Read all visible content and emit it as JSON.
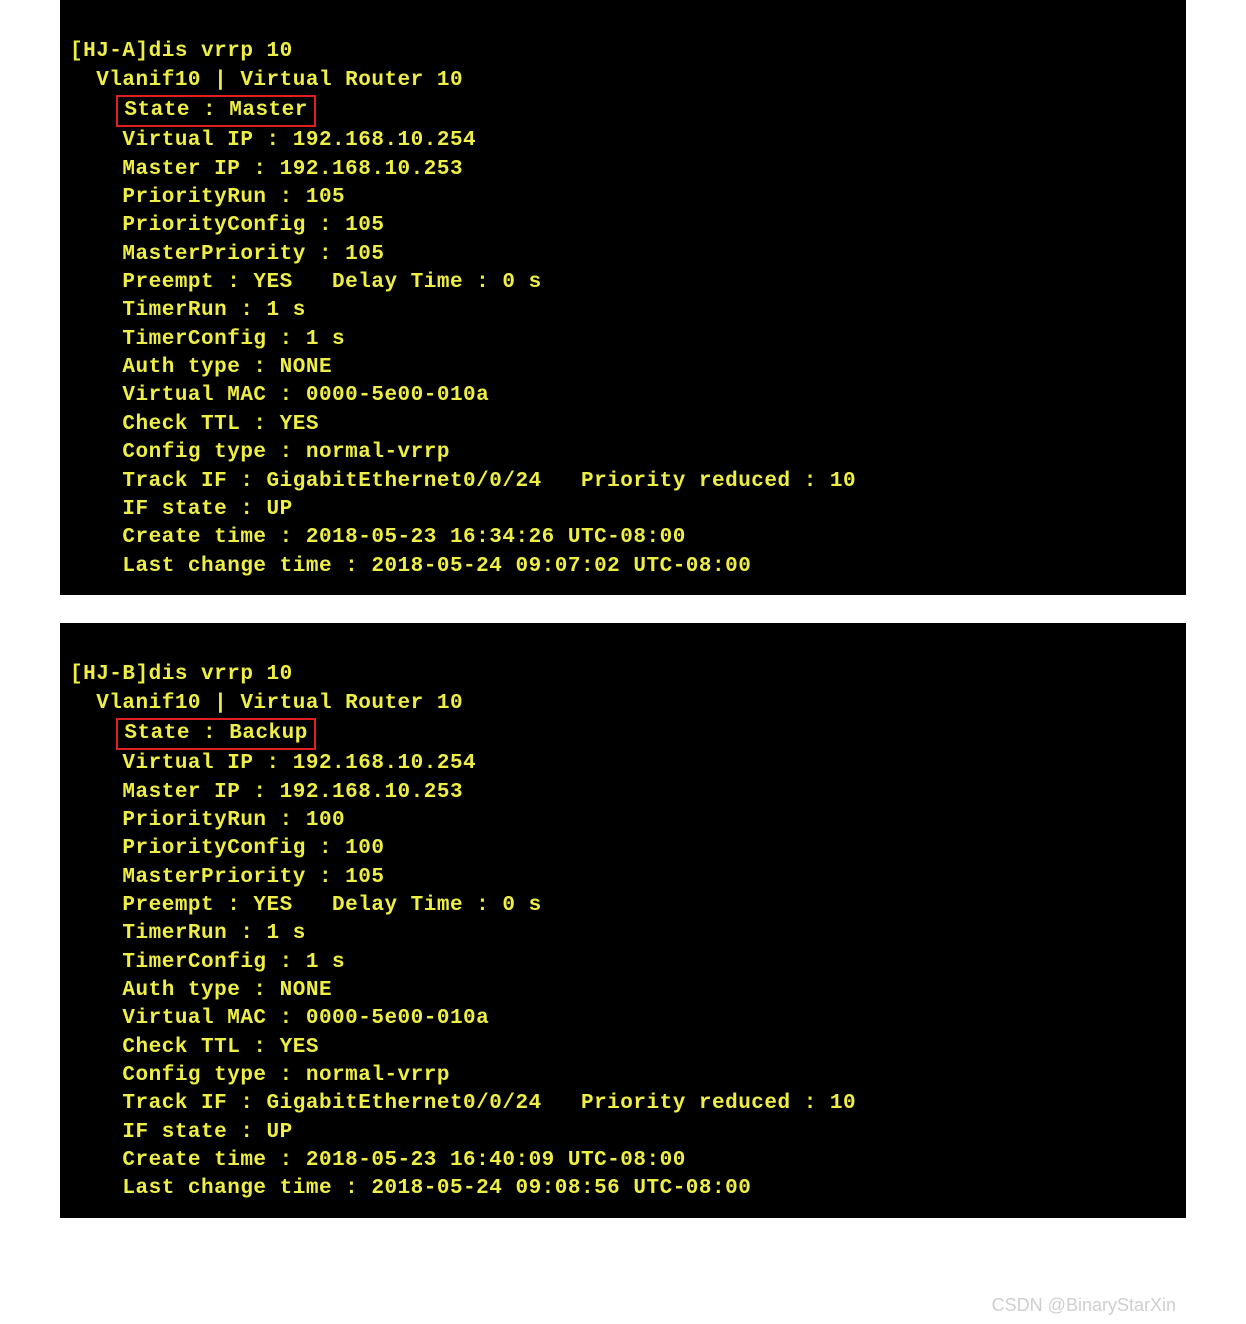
{
  "watermark": "CSDN @BinaryStarXin",
  "blocks": [
    {
      "id": "a",
      "prompt": "[HJ-A]dis vrrp 10",
      "header": "  Vlanif10 | Virtual Router 10",
      "state_line": "State : Master",
      "lines": [
        "    Virtual IP : 192.168.10.254",
        "    Master IP : 192.168.10.253",
        "    PriorityRun : 105",
        "    PriorityConfig : 105",
        "    MasterPriority : 105",
        "    Preempt : YES   Delay Time : 0 s",
        "    TimerRun : 1 s",
        "    TimerConfig : 1 s",
        "    Auth type : NONE",
        "    Virtual MAC : 0000-5e00-010a",
        "    Check TTL : YES",
        "    Config type : normal-vrrp",
        "    Track IF : GigabitEthernet0/0/24   Priority reduced : 10",
        "    IF state : UP",
        "    Create time : 2018-05-23 16:34:26 UTC-08:00",
        "    Last change time : 2018-05-24 09:07:02 UTC-08:00"
      ]
    },
    {
      "id": "b",
      "prompt": "[HJ-B]dis vrrp 10",
      "header": "  Vlanif10 | Virtual Router 10",
      "state_line": "State : Backup",
      "lines": [
        "    Virtual IP : 192.168.10.254",
        "    Master IP : 192.168.10.253",
        "    PriorityRun : 100",
        "    PriorityConfig : 100",
        "    MasterPriority : 105",
        "    Preempt : YES   Delay Time : 0 s",
        "    TimerRun : 1 s",
        "    TimerConfig : 1 s",
        "    Auth type : NONE",
        "    Virtual MAC : 0000-5e00-010a",
        "    Check TTL : YES",
        "    Config type : normal-vrrp",
        "    Track IF : GigabitEthernet0/0/24   Priority reduced : 10",
        "    IF state : UP",
        "    Create time : 2018-05-23 16:40:09 UTC-08:00",
        "    Last change time : 2018-05-24 09:08:56 UTC-08:00"
      ]
    }
  ]
}
